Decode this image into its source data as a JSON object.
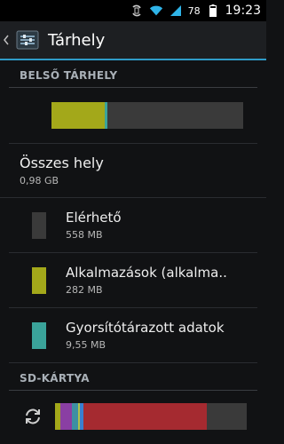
{
  "status": {
    "battery": "78",
    "time": "19:23"
  },
  "actionbar": {
    "title": "Tárhely"
  },
  "internal": {
    "header": "BELSŐ TÁRHELY",
    "usage": {
      "available_fraction": 0.71,
      "apps_fraction": 0.28,
      "cache_fraction": 0.01
    },
    "total_label": "Összes hely",
    "total_value": "0,98 GB",
    "items": [
      {
        "name": "Elérhető",
        "size": "558 MB",
        "color": "#3a3a3a"
      },
      {
        "name": "Alkalmazások (alkalma..",
        "size": "282 MB",
        "color": "#a3a81a"
      },
      {
        "name": "Gyorsítótárazott adatok",
        "size": "9,55 MB",
        "color": "#3aa39a"
      }
    ]
  },
  "sd": {
    "header": "SD-KÁRTYA",
    "segments": [
      {
        "name": "apps",
        "color": "#a3a81a",
        "fraction": 0.03
      },
      {
        "name": "pictures",
        "color": "#8a3fa3",
        "fraction": 0.06
      },
      {
        "name": "audio",
        "color": "#3d8fa3",
        "fraction": 0.03
      },
      {
        "name": "downloads",
        "color": "#b0c04a",
        "fraction": 0.01
      },
      {
        "name": "misc",
        "color": "#3a7fd0",
        "fraction": 0.02
      },
      {
        "name": "other",
        "color": "#a52a30",
        "fraction": 0.64
      }
    ]
  }
}
